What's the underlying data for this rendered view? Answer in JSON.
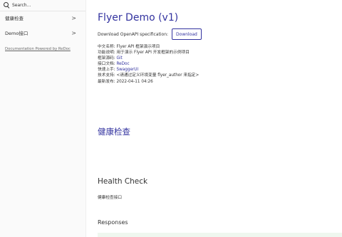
{
  "sidebar": {
    "search_placeholder": "Search...",
    "items": [
      {
        "label": "健康检查",
        "chevron": ">"
      },
      {
        "label": "Demo接口",
        "chevron": ">"
      }
    ],
    "powered_by": "Documentation Powered by ReDoc"
  },
  "main": {
    "title": "Flyer Demo (v1)",
    "download_label": "Download OpenAPI specification:",
    "download_button": "Download",
    "info": [
      {
        "label": "中文名称: ",
        "value": "Flyer API 框架演示项目",
        "link": false
      },
      {
        "label": "功能说明: ",
        "value": "用于演示 Flyer API 开发框架的示例项目",
        "link": false
      },
      {
        "label": "框架源码: ",
        "value": "Git",
        "link": true
      },
      {
        "label": "接口文档: ",
        "value": "ReDoc",
        "link": true
      },
      {
        "label": "快速上手: ",
        "value": "SwaggerUI",
        "link": true
      },
      {
        "label": "技术支持: ",
        "value": "<请通过定义环境变量 flyer_author 来指定>",
        "link": false
      },
      {
        "label": "最新发布: ",
        "value": "2022-04-11 04:26",
        "link": false
      }
    ],
    "section_title": "健康检查",
    "operation_title": "Health Check",
    "operation_desc": "健康检查接口",
    "responses_title": "Responses"
  },
  "colors": {
    "accent": "#32329f",
    "sidebar_bg": "#fafafa",
    "response_bg": "#eff7ef"
  },
  "icons": {
    "search": "search-icon",
    "chevron": "chevron-right-icon"
  }
}
